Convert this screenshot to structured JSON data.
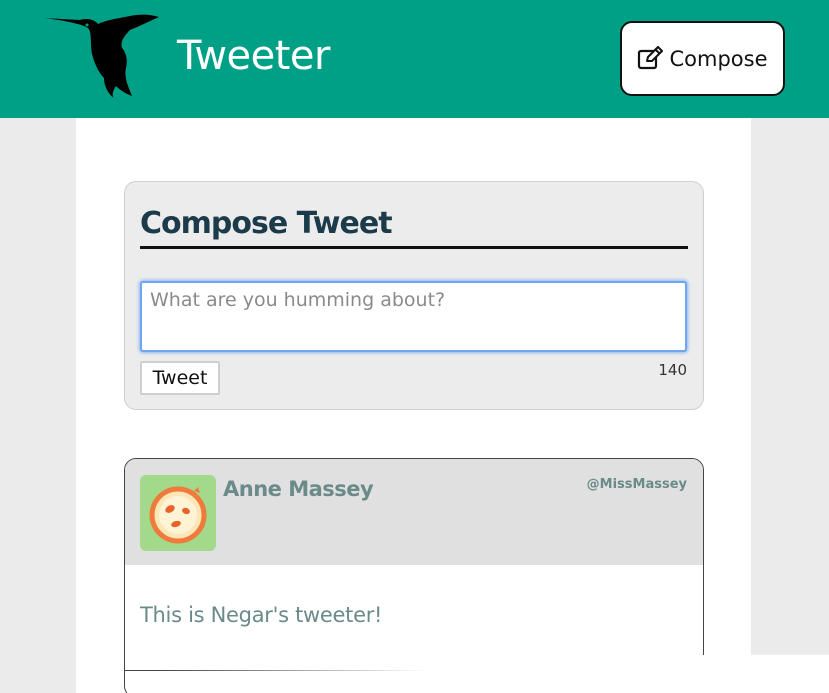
{
  "header": {
    "logo": "hummingbird-logo",
    "title": "Tweeter",
    "compose_button": {
      "label": "Compose",
      "icon": "edit-icon"
    }
  },
  "compose": {
    "heading": "Compose Tweet",
    "input": {
      "value": "",
      "placeholder": "What are you humming about?"
    },
    "submit_label": "Tweet",
    "counter": "140"
  },
  "tweets": [
    {
      "avatar": "avatar-icon",
      "name": "Anne Massey",
      "handle": "@MissMassey",
      "content": "This is Negar's tweeter!"
    }
  ],
  "colors": {
    "nav_bg": "#00a087",
    "heading": "#1b3a4a",
    "muted_text": "#6b8a8a",
    "avatar_bg": "#a3d98b"
  }
}
